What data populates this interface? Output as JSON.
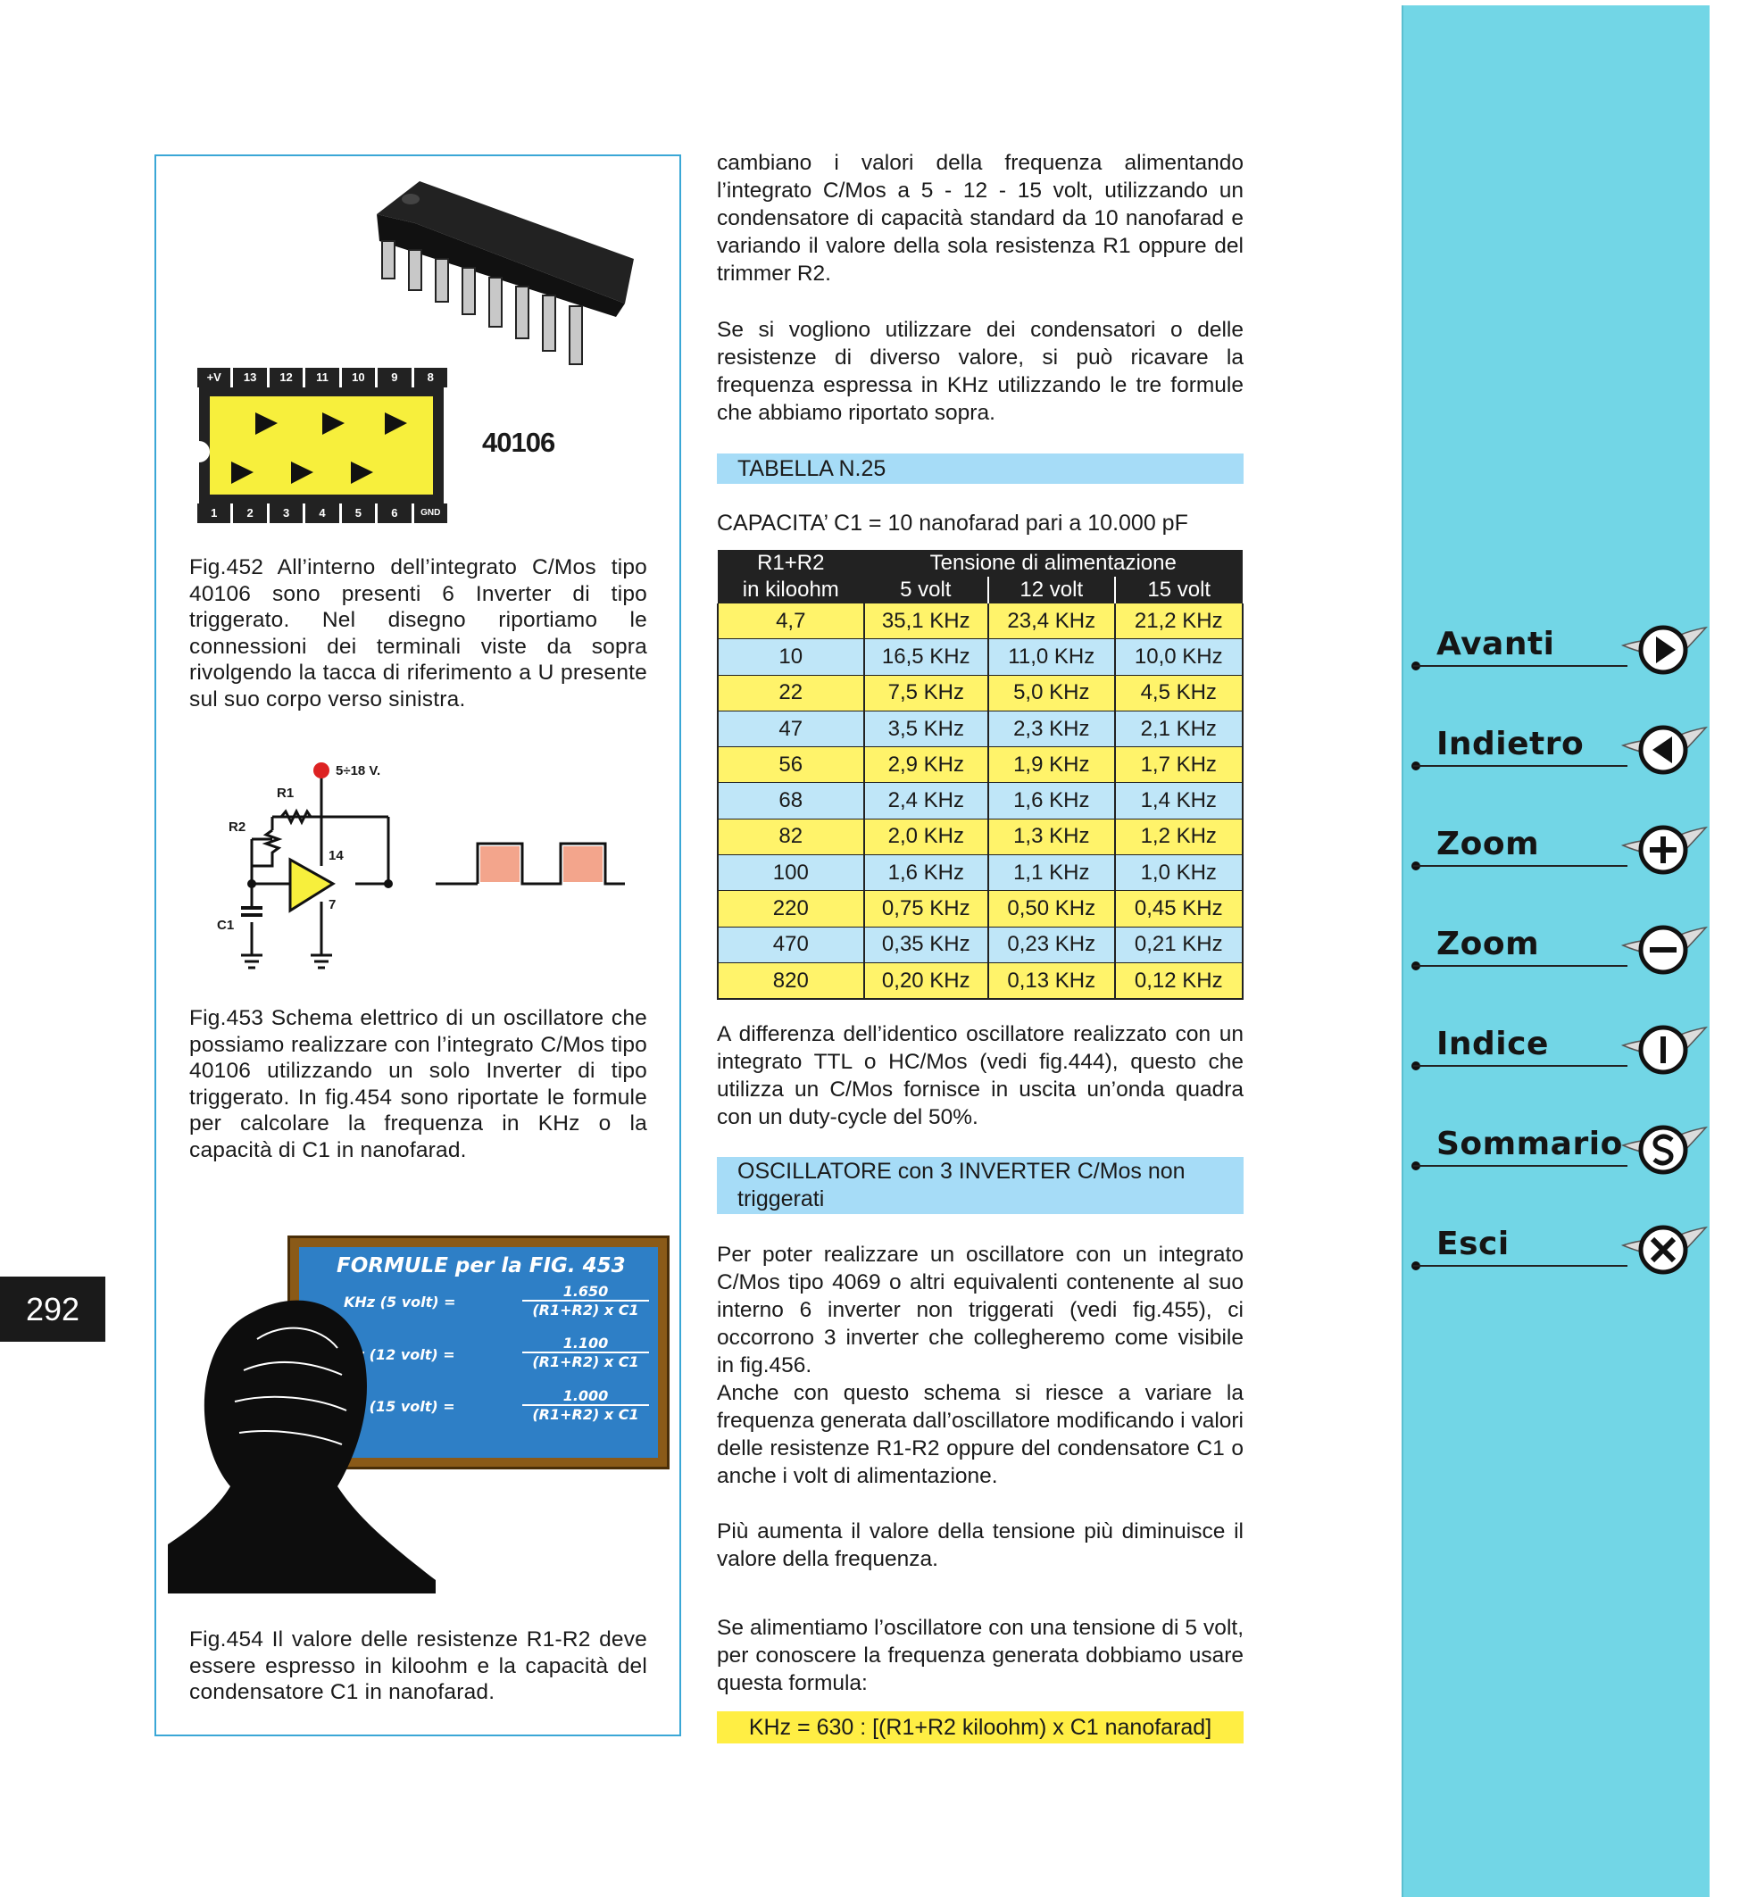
{
  "page_number": "292",
  "figures": {
    "ic_label": "40106",
    "ic_pins_top": [
      "+V",
      "13",
      "12",
      "11",
      "10",
      "9",
      "8"
    ],
    "ic_pins_bottom": [
      "1",
      "2",
      "3",
      "4",
      "5",
      "6",
      "GND"
    ],
    "fig452_caption": "Fig.452 All’interno dell’integrato C/Mos tipo 40106 sono presenti 6 Inverter di tipo triggerato. Nel disegno riportiamo le connessioni dei terminali viste da sopra rivolgendo la tacca di riferimento a U presente sul suo corpo verso sinistra.",
    "schematic": {
      "supply": "5÷18 V.",
      "r1": "R1",
      "r2": "R2",
      "c1": "C1",
      "pin14": "14",
      "pin7": "7"
    },
    "fig453_caption": "Fig.453 Schema elettrico di un oscillatore che possiamo realizzare con l’integrato C/Mos tipo 40106 utilizzando un solo Inverter di tipo triggerato. In fig.454 sono riportate le formule per calcolare la frequenza in KHz o la capacità di C1 in nanofarad.",
    "board": {
      "title": "FORMULE per la FIG. 453",
      "rows": [
        {
          "label": "KHz (5 volt) =",
          "num": "1.650",
          "den": "(R1+R2) x C1"
        },
        {
          "label": "KHz (12 volt) =",
          "num": "1.100",
          "den": "(R1+R2) x C1"
        },
        {
          "label": "KHz (15 volt) =",
          "num": "1.000",
          "den": "(R1+R2) x C1"
        }
      ]
    },
    "fig454_caption": "Fig.454 Il valore delle resistenze R1-R2 deve essere espresso in kiloohm e la capacità del condensatore C1 in nanofarad."
  },
  "text": {
    "p1": "cambiano i valori della frequenza alimentando l’integrato C/Mos a 5 - 12 - 15 volt, utilizzando un condensatore di capacità standard da 10 nanofarad e variando il valore della sola resistenza R1 oppure del trimmer R2.",
    "p2": "Se si vogliono utilizzare dei condensatori o delle resistenze di diverso valore, si può ricavare la frequenza espressa in KHz utilizzando le tre formule che abbiamo riportato sopra.",
    "table_title": "TABELLA N.25",
    "capacity_line": "CAPACITA’ C1 = 10 nanofarad pari a 10.000 pF",
    "p3": "A differenza dell’identico oscillatore realizzato con un integrato TTL o HC/Mos (vedi fig.444), questo che utilizza un C/Mos fornisce in uscita un’onda quadra con un duty-cycle del 50%.",
    "section_title": "OSCILLATORE con 3 INVERTER C/Mos non triggerati",
    "p4": "Per poter realizzare un oscillatore con un integrato C/Mos tipo 4069 o altri equivalenti contenente al suo interno 6 inverter non triggerati (vedi fig.455), ci occorrono 3 inverter che collegheremo come visibile in fig.456.",
    "p5": "Anche con questo schema si riesce a variare la frequenza generata dall’oscillatore modificando i valori delle resistenze R1-R2 oppure del condensatore C1 o anche i volt di alimentazione.",
    "p6": "Più aumenta il valore della tensione più diminuisce il valore della frequenza.",
    "p7": "Se alimentiamo l’oscillatore con una tensione di 5 volt, per conoscere la frequenza generata dobbiamo usare questa formula:",
    "formula": "KHz = 630 : [(R1+R2 kiloohm) x C1 nanofarad]"
  },
  "table": {
    "header_col1_line1": "R1+R2",
    "header_col1_line2": "in kiloohm",
    "header_group": "Tensione di alimentazione",
    "header_cols": [
      "5 volt",
      "12 volt",
      "15 volt"
    ],
    "rows": [
      [
        "4,7",
        "35,1 KHz",
        "23,4 KHz",
        "21,2 KHz"
      ],
      [
        "10",
        "16,5 KHz",
        "11,0 KHz",
        "10,0 KHz"
      ],
      [
        "22",
        "7,5 KHz",
        "5,0 KHz",
        "4,5 KHz"
      ],
      [
        "47",
        "3,5 KHz",
        "2,3 KHz",
        "2,1 KHz"
      ],
      [
        "56",
        "2,9 KHz",
        "1,9 KHz",
        "1,7 KHz"
      ],
      [
        "68",
        "2,4 KHz",
        "1,6 KHz",
        "1,4 KHz"
      ],
      [
        "82",
        "2,0 KHz",
        "1,3 KHz",
        "1,2 KHz"
      ],
      [
        "100",
        "1,6 KHz",
        "1,1 KHz",
        "1,0 KHz"
      ],
      [
        "220",
        "0,75 KHz",
        "0,50 KHz",
        "0,45 KHz"
      ],
      [
        "470",
        "0,35 KHz",
        "0,23 KHz",
        "0,21 KHz"
      ],
      [
        "820",
        "0,20 KHz",
        "0,13 KHz",
        "0,12 KHz"
      ]
    ]
  },
  "nav": [
    {
      "label": "Avanti",
      "icon": "arrow-right-icon"
    },
    {
      "label": "Indietro",
      "icon": "arrow-left-icon"
    },
    {
      "label": "Zoom",
      "icon": "plus-icon"
    },
    {
      "label": "Zoom",
      "icon": "minus-icon"
    },
    {
      "label": "Indice",
      "icon": "index-i-icon"
    },
    {
      "label": "Sommario",
      "icon": "summary-s-icon"
    },
    {
      "label": "Esci",
      "icon": "close-x-icon"
    }
  ],
  "colors": {
    "sidebar": "#72d6e6",
    "ic_body": "#f7ef3c",
    "table_yellow": "#fff36a",
    "table_blue": "#bfe6f8",
    "section_bar": "#a6dcf7",
    "formula_bar": "#ffee44",
    "board": "#2e7fc6",
    "square_wave": "#f3a58c"
  }
}
